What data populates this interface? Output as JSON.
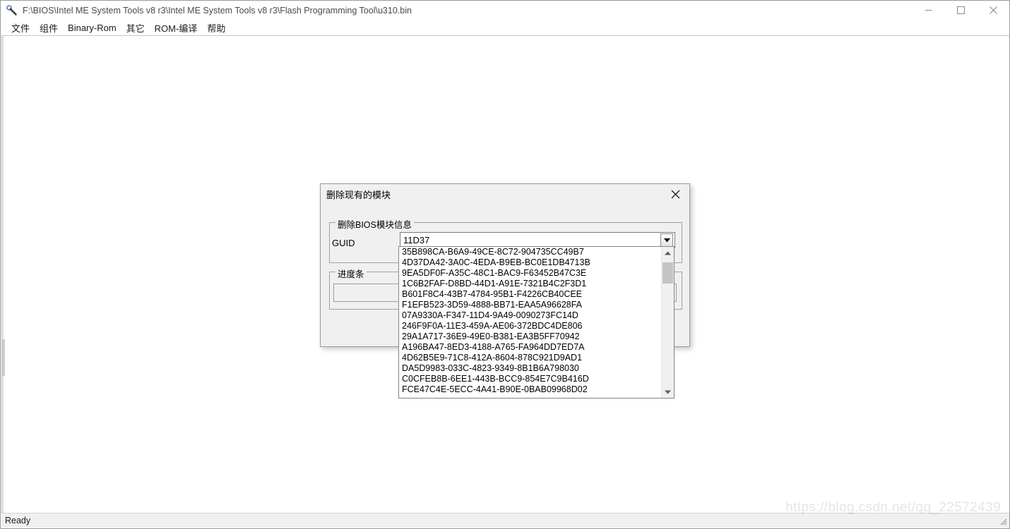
{
  "window": {
    "title": "F:\\BIOS\\Intel ME System Tools v8 r3\\Intel ME System Tools v8 r3\\Flash Programming Tool\\u310.bin",
    "icon": "wrench-icon",
    "minimize_label": "─",
    "maximize_label": "□",
    "close_label": "✕"
  },
  "menu": {
    "items": [
      {
        "label": "文件"
      },
      {
        "label": "组件"
      },
      {
        "label": "Binary-Rom"
      },
      {
        "label": "其它"
      },
      {
        "label": "ROM-编译"
      },
      {
        "label": "帮助"
      }
    ]
  },
  "status_bar": {
    "text": "Ready",
    "watermark": "https://blog.csdn.net/qq_22572439"
  },
  "dialog": {
    "title": "删除现有的模块",
    "close_label": "✕",
    "bios_group": {
      "legend": "删除BIOS模块信息",
      "guid_label": "GUID",
      "guid_value": "11D37",
      "guid_placeholder": "",
      "dropdown_arrow": "▼"
    },
    "progress_group": {
      "legend": "进度条",
      "percent": 0
    }
  },
  "dropdown": {
    "scroll_up_label": "∧",
    "scroll_down_label": "∨",
    "items": [
      "35B898CA-B6A9-49CE-8C72-904735CC49B7",
      "4D37DA42-3A0C-4EDA-B9EB-BC0E1DB4713B",
      "9EA5DF0F-A35C-48C1-BAC9-F63452B47C3E",
      "1C6B2FAF-D8BD-44D1-A91E-7321B4C2F3D1",
      "B601F8C4-43B7-4784-95B1-F4226CB40CEE",
      "F1EFB523-3D59-4888-BB71-EAA5A96628FA",
      "07A9330A-F347-11D4-9A49-0090273FC14D",
      "246F9F0A-11E3-459A-AE06-372BDC4DE806",
      "29A1A717-36E9-49E0-B381-EA3B5FF70942",
      "A196BA47-8ED3-4188-A765-FA964DD7ED7A",
      "4D62B5E9-71C8-412A-8604-878C921D9AD1",
      "DA5D9983-033C-4823-9349-8B1B6A798030",
      "C0CFEB8B-6EE1-443B-BCC9-854E7C9B416D",
      "FCE47C4E-5ECC-4A41-B90E-0BAB09968D02"
    ]
  }
}
